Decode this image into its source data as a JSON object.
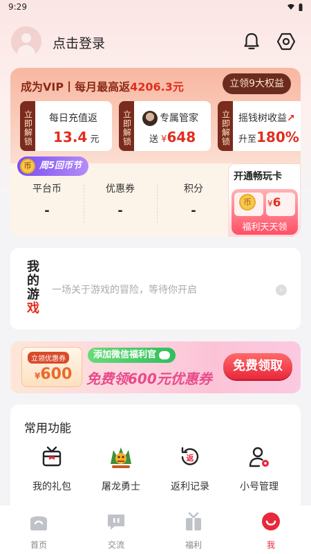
{
  "status": {
    "time": "9:29"
  },
  "header": {
    "login": "点击登录"
  },
  "vip": {
    "title_prefix": "成为VIP丨每月最高返",
    "amount": "4206.3元",
    "benefits_button": "立领9大权益",
    "unlock_tag": "立即解锁",
    "benefits": [
      {
        "title": "每日充值返",
        "value": "13.4",
        "unit": "元"
      },
      {
        "title": "专属管家",
        "prefix": "送",
        "currency": "¥",
        "value": "648"
      },
      {
        "title": "摇钱树收益",
        "prefix": "升至",
        "value": "180%"
      }
    ]
  },
  "festival": {
    "coin": "币",
    "label": "周5回币节"
  },
  "stats": [
    {
      "label": "平台币",
      "value": "-"
    },
    {
      "label": "优惠券",
      "value": "-"
    },
    {
      "label": "积分",
      "value": "-"
    }
  ],
  "open_card": {
    "title": "开通畅玩卡",
    "coin": "币",
    "currency": "¥",
    "value": "6",
    "subtitle": "福利天天领"
  },
  "games": {
    "logo": [
      "我",
      "的",
      "游",
      "戏"
    ],
    "text": "一场关于游戏的冒险，等待你开启",
    "arrow": "›"
  },
  "banner": {
    "ticket_label": "立领优惠券",
    "ticket_currency": "¥",
    "ticket_value": "600",
    "wechat": "添加微信福利官",
    "main": "免费领600元优惠券",
    "button": "免费领取"
  },
  "functions": {
    "title": "常用功能",
    "items": [
      {
        "label": "我的礼包",
        "icon": "gift-icon"
      },
      {
        "label": "屠龙勇士",
        "icon": "dragon-icon"
      },
      {
        "label": "返利记录",
        "icon": "rebate-icon"
      },
      {
        "label": "小号管理",
        "icon": "sub-account-icon"
      }
    ]
  },
  "tabs": [
    {
      "label": "首页",
      "icon": "home-icon"
    },
    {
      "label": "交流",
      "icon": "chat-icon"
    },
    {
      "label": "福利",
      "icon": "gift-box-icon"
    },
    {
      "label": "我",
      "icon": "me-icon"
    }
  ],
  "colors": {
    "accent": "#e8283c",
    "vip_brown": "#7a2b1d",
    "festival_purple": "#7a4ef0"
  }
}
